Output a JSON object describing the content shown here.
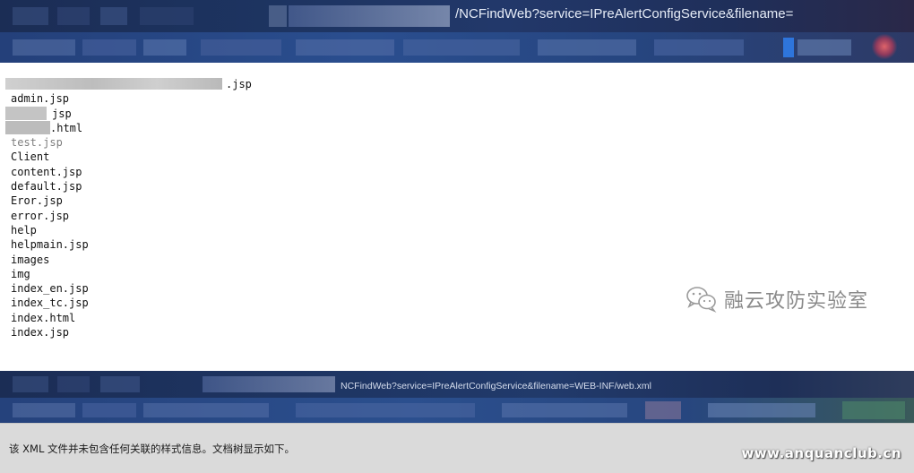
{
  "browser_top": {
    "url_text": "/NCFindWeb?service=IPreAlertConfigService&filename="
  },
  "listing": {
    "items": [
      ".jsp",
      "admin.jsp",
      "jsp",
      ".html",
      "test.jsp",
      "Client",
      "content.jsp",
      "default.jsp",
      "Eror.jsp",
      "error.jsp",
      "help",
      "helpmain.jsp",
      "images",
      "img",
      "index_en.jsp",
      "index_tc.jsp",
      "index.html",
      "index.jsp"
    ]
  },
  "watermark": {
    "icon": "wechat-icon",
    "text": "融云攻防实验室"
  },
  "browser_bottom": {
    "url_text": "NCFindWeb?service=IPreAlertConfigService&filename=WEB-INF/web.xml"
  },
  "xml_bar": {
    "message": "该 XML 文件并未包含任何关联的样式信息。文档树显示如下。"
  },
  "site_watermark": "www.anquanclub.cn",
  "colors": {
    "chrome_dark": "#1d3461",
    "chrome_tab": "#2a4e8f",
    "xml_bar_bg": "#dadada",
    "watermark_gray": "#8a8a8a"
  }
}
